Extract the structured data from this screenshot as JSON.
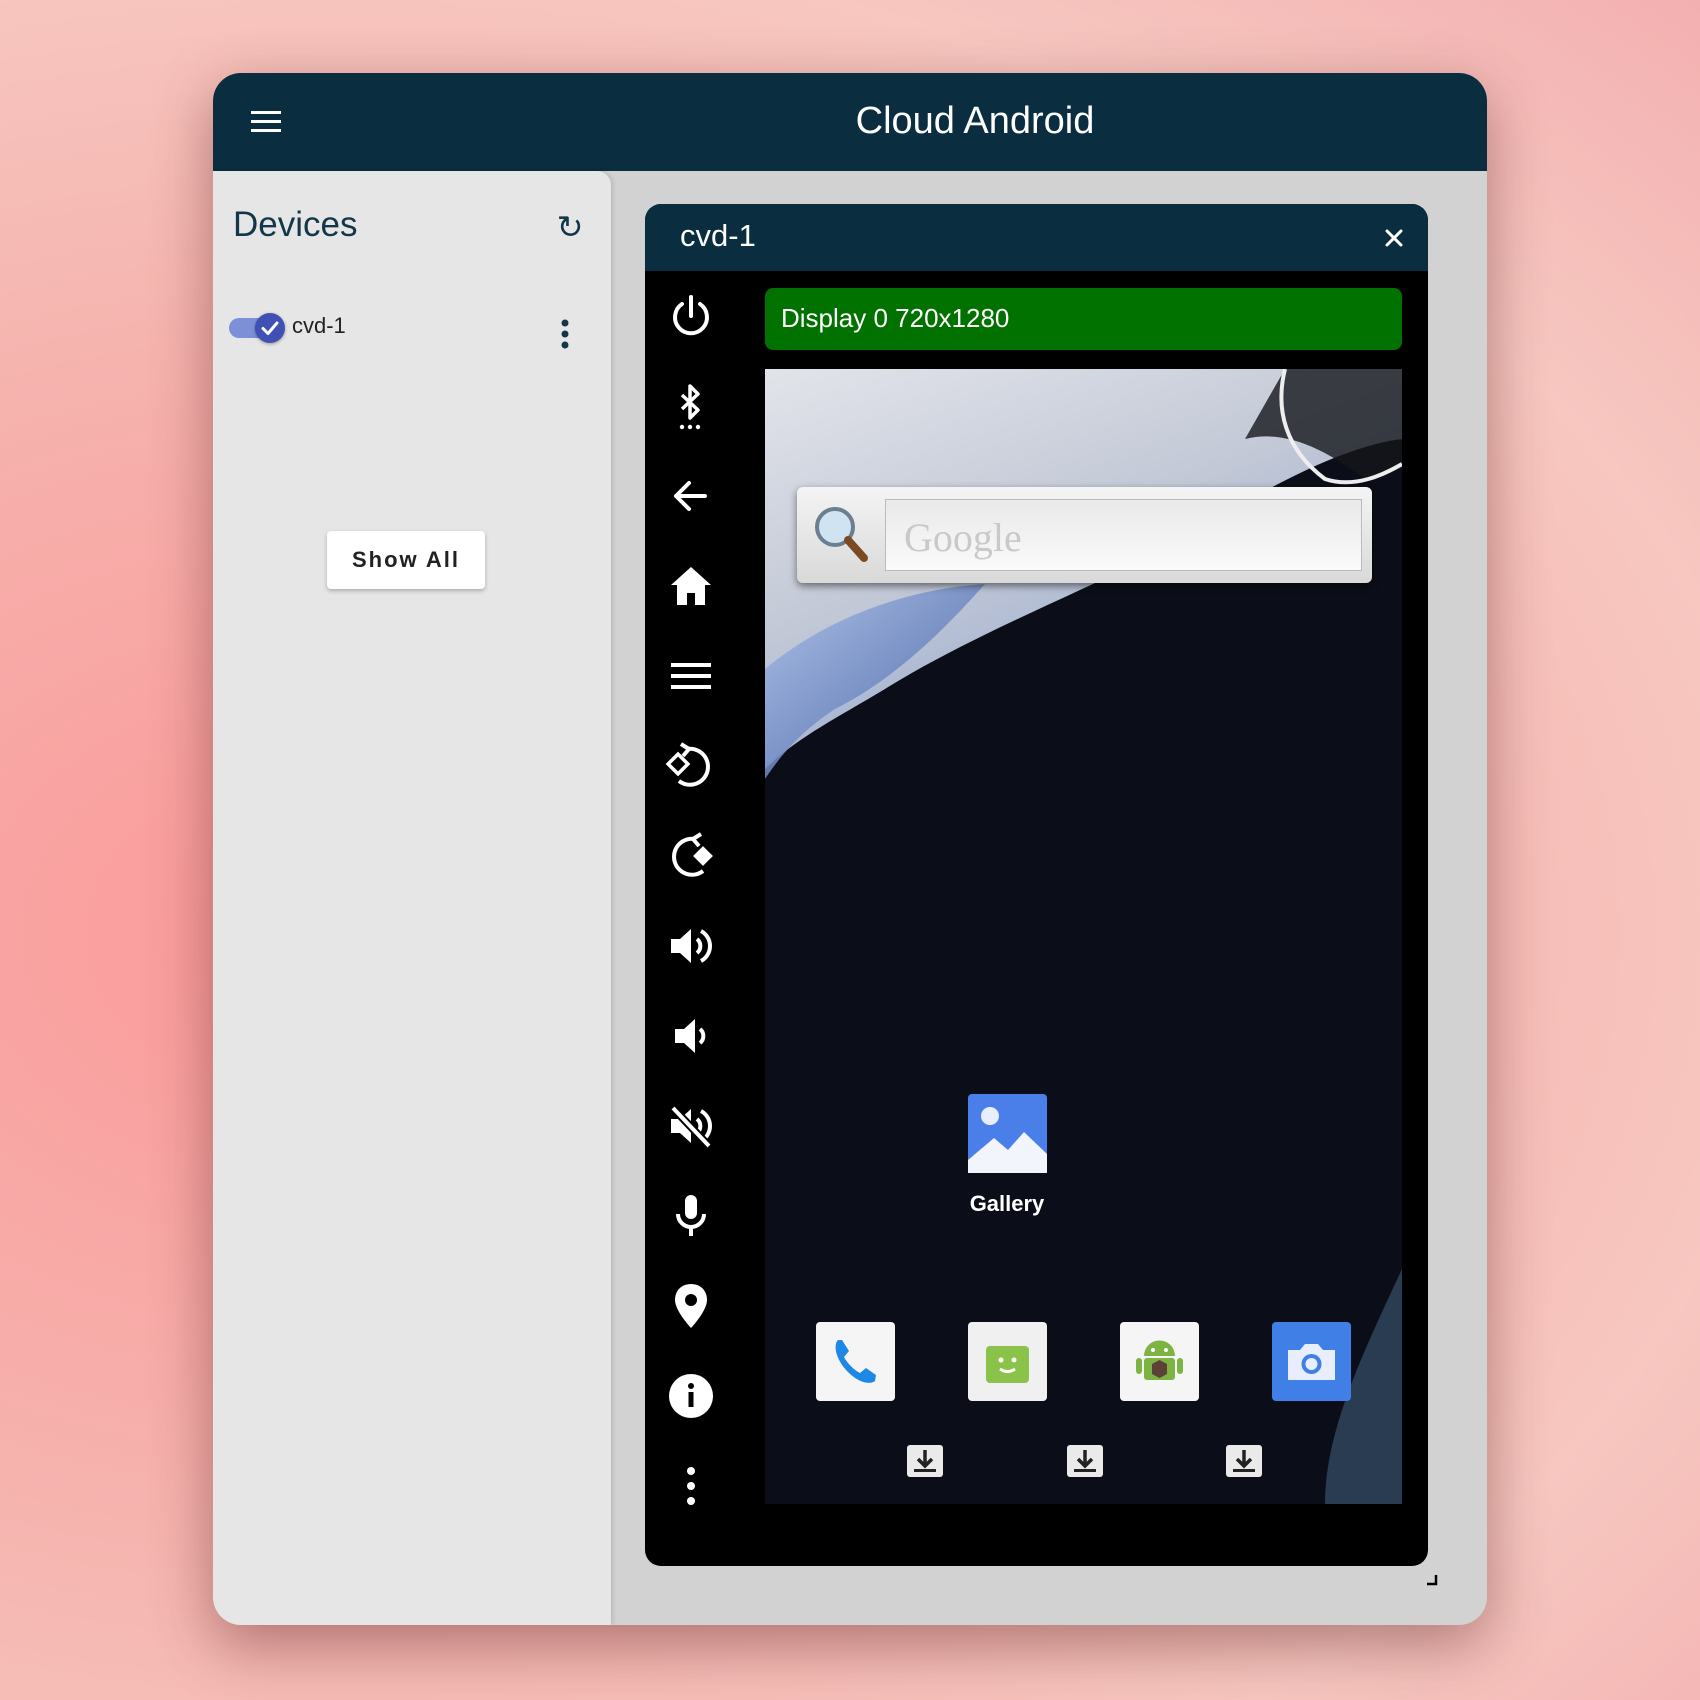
{
  "app": {
    "title": "Cloud Android"
  },
  "sidebar": {
    "title": "Devices",
    "devices": [
      {
        "name": "cvd-1",
        "enabled": true
      }
    ],
    "show_all_label": "Show All"
  },
  "device_panel": {
    "title": "cvd-1",
    "display_label": "Display 0 720x1280",
    "controls": [
      "power-icon",
      "bluetooth-icon",
      "back-icon",
      "home-icon",
      "menu-icon",
      "rotate-left-icon",
      "rotate-right-icon",
      "volume-up-icon",
      "volume-down-icon",
      "volume-mute-icon",
      "microphone-icon",
      "location-icon",
      "info-icon",
      "more-options-icon"
    ]
  },
  "screen": {
    "search_placeholder": "Google",
    "gallery_label": "Gallery",
    "dock_apps": [
      "phone-app-icon",
      "messaging-app-icon",
      "android-app-icon",
      "camera-app-icon"
    ]
  },
  "colors": {
    "topbar": "#0a2d40",
    "display_bar": "#017100",
    "sidebar_bg": "#e6e6e6",
    "toggle": "#3f51b5"
  }
}
